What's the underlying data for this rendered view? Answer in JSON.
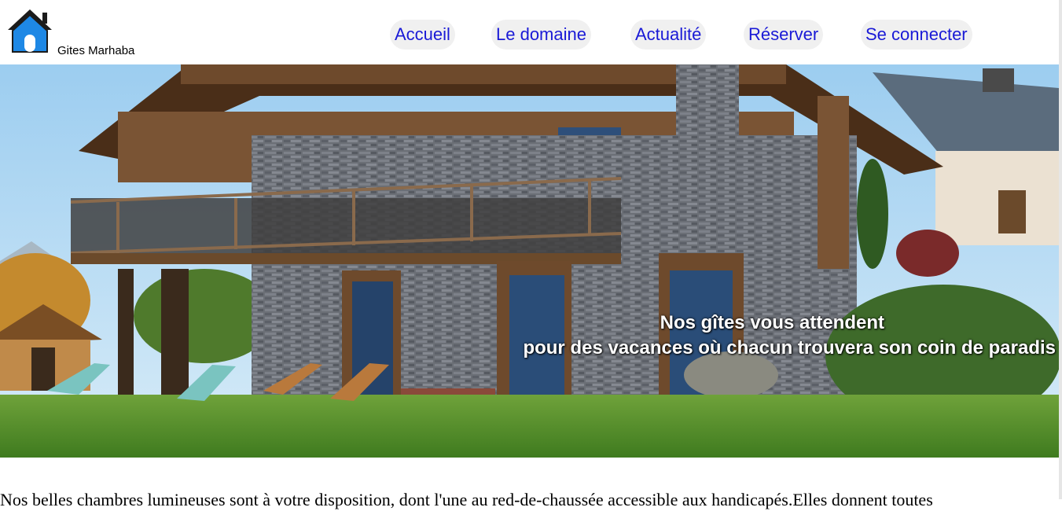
{
  "header": {
    "site_name": "Gites Marhaba",
    "logo_icon": "house-icon",
    "logo_color": "#1e88e5"
  },
  "nav": {
    "items": [
      {
        "label": "Accueil"
      },
      {
        "label": "Le domaine"
      },
      {
        "label": "Actualité"
      },
      {
        "label": "Réserver"
      },
      {
        "label": "Se connecter"
      }
    ],
    "link_color": "#1a1ad6",
    "pill_color": "#f0f0f0"
  },
  "hero": {
    "tagline_line1": "Nos gîtes vous attendent",
    "tagline_line2": "pour des vacances où chacun trouvera son coin de paradis"
  },
  "intro": {
    "text": "Nos belles chambres lumineuses sont à votre disposition, dont l'une au red-de-chaussée accessible aux handicapés.Elles donnent toutes"
  }
}
